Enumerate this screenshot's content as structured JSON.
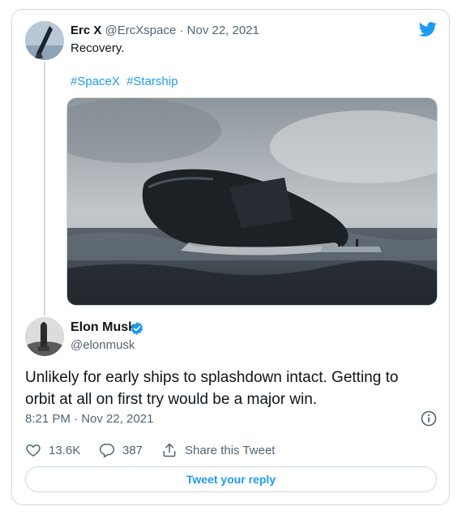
{
  "quoted": {
    "name": "Erc X",
    "handle": "@ErcXspace",
    "date": "Nov 22, 2021",
    "text": "Recovery.",
    "hashtags": [
      "#SpaceX",
      "#Starship"
    ]
  },
  "tweet": {
    "name": "Elon Musk",
    "handle": "@elonmusk",
    "text": "Unlikely for early ships to splashdown intact. Getting to orbit at all on first try would be a major win.",
    "timestamp": "8:21 PM · Nov 22, 2021"
  },
  "actions": {
    "likes": "13.6K",
    "replies": "387",
    "share_label": "Share this Tweet"
  },
  "reply_button": "Tweet your reply",
  "colors": {
    "accent": "#1d9bf0",
    "secondary_text": "#536471",
    "border": "#cfd9de"
  },
  "icons": [
    "twitter-logo-icon",
    "verified-badge-icon",
    "info-icon",
    "heart-icon",
    "reply-icon",
    "share-icon"
  ]
}
